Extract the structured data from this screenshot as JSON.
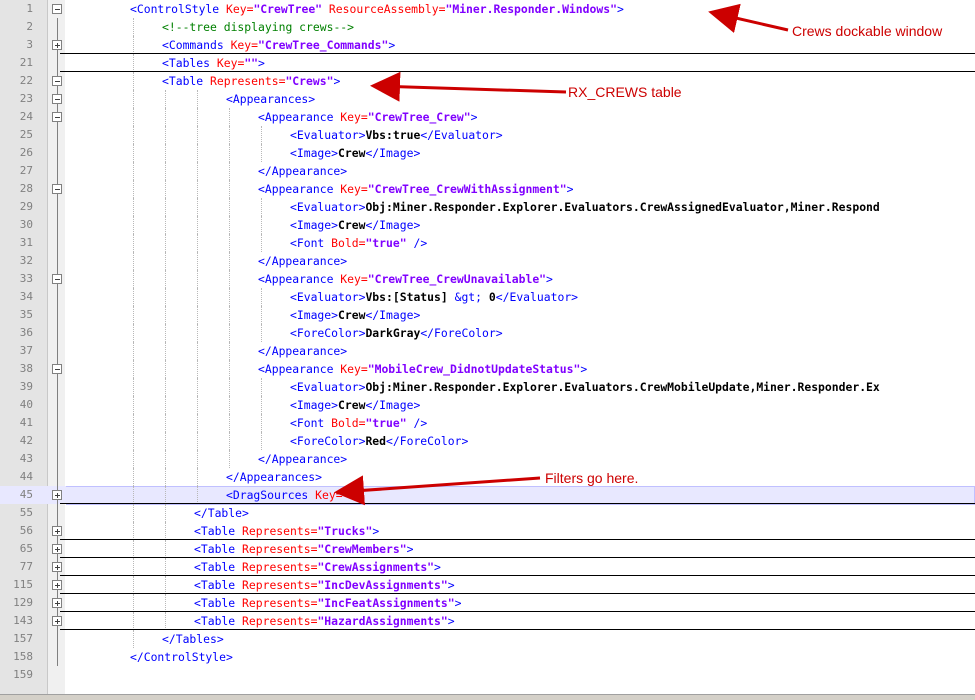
{
  "annotations": {
    "crews_window": "Crews dockable window",
    "rx_crews": "RX_CREWS table",
    "filters": "Filters go here."
  },
  "lines": [
    {
      "n": "1",
      "fold": "open",
      "parts": [
        [
          "t",
          "<ControlStyle "
        ],
        [
          "a",
          "Key="
        ],
        [
          "v",
          "\"CrewTree\""
        ],
        [
          "t",
          " "
        ],
        [
          "a",
          "ResourceAssembly="
        ],
        [
          "v",
          "\"Miner.Responder.Windows\""
        ],
        [
          "t",
          ">"
        ]
      ]
    },
    {
      "n": "2",
      "parts": [
        [
          "c",
          "<!--tree displaying crews-->"
        ]
      ]
    },
    {
      "n": "3",
      "fold": "closed",
      "parts": [
        [
          "t",
          "<Commands "
        ],
        [
          "a",
          "Key="
        ],
        [
          "v",
          "\"CrewTree_Commands\""
        ],
        [
          "t",
          ">"
        ]
      ]
    },
    {
      "n": "21",
      "parts": [
        [
          "t",
          "<Tables "
        ],
        [
          "a",
          "Key="
        ],
        [
          "v",
          "\"\""
        ],
        [
          "t",
          ">"
        ]
      ]
    },
    {
      "n": "22",
      "fold": "open",
      "parts": [
        [
          "t",
          "<Table "
        ],
        [
          "a",
          "Represents="
        ],
        [
          "v",
          "\"Crews\""
        ],
        [
          "t",
          ">"
        ]
      ]
    },
    {
      "n": "23",
      "fold": "open",
      "parts": [
        [
          "t",
          "<Appearances>"
        ]
      ]
    },
    {
      "n": "24",
      "fold": "open",
      "parts": [
        [
          "t",
          "<Appearance "
        ],
        [
          "a",
          "Key="
        ],
        [
          "v",
          "\"CrewTree_Crew\""
        ],
        [
          "t",
          ">"
        ]
      ]
    },
    {
      "n": "25",
      "parts": [
        [
          "t",
          "<Evaluator>"
        ],
        [
          "tx",
          "Vbs:true"
        ],
        [
          "t",
          "</Evaluator>"
        ]
      ]
    },
    {
      "n": "26",
      "parts": [
        [
          "t",
          "<Image>"
        ],
        [
          "tx",
          "Crew"
        ],
        [
          "t",
          "</Image>"
        ]
      ]
    },
    {
      "n": "27",
      "parts": [
        [
          "t",
          "</Appearance>"
        ]
      ]
    },
    {
      "n": "28",
      "fold": "open",
      "parts": [
        [
          "t",
          "<Appearance "
        ],
        [
          "a",
          "Key="
        ],
        [
          "v",
          "\"CrewTree_CrewWithAssignment\""
        ],
        [
          "t",
          ">"
        ]
      ]
    },
    {
      "n": "29",
      "parts": [
        [
          "t",
          "<Evaluator>"
        ],
        [
          "tx",
          "Obj:Miner.Responder.Explorer.Evaluators.CrewAssignedEvaluator,Miner.Respond"
        ]
      ]
    },
    {
      "n": "30",
      "parts": [
        [
          "t",
          "<Image>"
        ],
        [
          "tx",
          "Crew"
        ],
        [
          "t",
          "</Image>"
        ]
      ]
    },
    {
      "n": "31",
      "parts": [
        [
          "t",
          "<Font "
        ],
        [
          "a",
          "Bold="
        ],
        [
          "v",
          "\"true\""
        ],
        [
          "t",
          " />"
        ]
      ]
    },
    {
      "n": "32",
      "parts": [
        [
          "t",
          "</Appearance>"
        ]
      ]
    },
    {
      "n": "33",
      "fold": "open",
      "parts": [
        [
          "t",
          "<Appearance "
        ],
        [
          "a",
          "Key="
        ],
        [
          "v",
          "\"CrewTree_CrewUnavailable\""
        ],
        [
          "t",
          ">"
        ]
      ]
    },
    {
      "n": "34",
      "parts": [
        [
          "t",
          "<Evaluator>"
        ],
        [
          "tx",
          "Vbs:[Status] "
        ],
        [
          "t",
          "&gt;"
        ],
        [
          "tx",
          " 0"
        ],
        [
          "t",
          "</Evaluator>"
        ]
      ]
    },
    {
      "n": "35",
      "parts": [
        [
          "t",
          "<Image>"
        ],
        [
          "tx",
          "Crew"
        ],
        [
          "t",
          "</Image>"
        ]
      ]
    },
    {
      "n": "36",
      "parts": [
        [
          "t",
          "<ForeColor>"
        ],
        [
          "tx",
          "DarkGray"
        ],
        [
          "t",
          "</ForeColor>"
        ]
      ]
    },
    {
      "n": "37",
      "parts": [
        [
          "t",
          "</Appearance>"
        ]
      ]
    },
    {
      "n": "38",
      "fold": "open",
      "parts": [
        [
          "t",
          "<Appearance "
        ],
        [
          "a",
          "Key="
        ],
        [
          "v",
          "\"MobileCrew_DidnotUpdateStatus\""
        ],
        [
          "t",
          ">"
        ]
      ]
    },
    {
      "n": "39",
      "parts": [
        [
          "t",
          "<Evaluator>"
        ],
        [
          "tx",
          "Obj:Miner.Responder.Explorer.Evaluators.CrewMobileUpdate,Miner.Responder.Ex"
        ]
      ]
    },
    {
      "n": "40",
      "parts": [
        [
          "t",
          "<Image>"
        ],
        [
          "tx",
          "Crew"
        ],
        [
          "t",
          "</Image>"
        ]
      ]
    },
    {
      "n": "41",
      "parts": [
        [
          "t",
          "<Font "
        ],
        [
          "a",
          "Bold="
        ],
        [
          "v",
          "\"true\""
        ],
        [
          "t",
          " />"
        ]
      ]
    },
    {
      "n": "42",
      "parts": [
        [
          "t",
          "<ForeColor>"
        ],
        [
          "tx",
          "Red"
        ],
        [
          "t",
          "</ForeColor>"
        ]
      ]
    },
    {
      "n": "43",
      "parts": [
        [
          "t",
          "</Appearance>"
        ]
      ]
    },
    {
      "n": "44",
      "parts": [
        [
          "t",
          "</Appearances>"
        ]
      ]
    },
    {
      "n": "45",
      "fold": "closed",
      "parts": [
        [
          "t",
          "<DragSources "
        ],
        [
          "a",
          "Key="
        ],
        [
          "v",
          "\"\""
        ],
        [
          "t",
          ">"
        ]
      ]
    },
    {
      "n": "55",
      "parts": [
        [
          "t",
          "</Table>"
        ]
      ]
    },
    {
      "n": "56",
      "fold": "closed",
      "parts": [
        [
          "t",
          "<Table "
        ],
        [
          "a",
          "Represents="
        ],
        [
          "v",
          "\"Trucks\""
        ],
        [
          "t",
          ">"
        ]
      ]
    },
    {
      "n": "65",
      "fold": "closed",
      "parts": [
        [
          "t",
          "<Table "
        ],
        [
          "a",
          "Represents="
        ],
        [
          "v",
          "\"CrewMembers\""
        ],
        [
          "t",
          ">"
        ]
      ]
    },
    {
      "n": "77",
      "fold": "closed",
      "parts": [
        [
          "t",
          "<Table "
        ],
        [
          "a",
          "Represents="
        ],
        [
          "v",
          "\"CrewAssignments\""
        ],
        [
          "t",
          ">"
        ]
      ]
    },
    {
      "n": "115",
      "fold": "closed",
      "parts": [
        [
          "t",
          "<Table "
        ],
        [
          "a",
          "Represents="
        ],
        [
          "v",
          "\"IncDevAssignments\""
        ],
        [
          "t",
          ">"
        ]
      ]
    },
    {
      "n": "129",
      "fold": "closed",
      "parts": [
        [
          "t",
          "<Table "
        ],
        [
          "a",
          "Represents="
        ],
        [
          "v",
          "\"IncFeatAssignments\""
        ],
        [
          "t",
          ">"
        ]
      ]
    },
    {
      "n": "143",
      "fold": "closed",
      "parts": [
        [
          "t",
          "<Table "
        ],
        [
          "a",
          "Represents="
        ],
        [
          "v",
          "\"HazardAssignments\""
        ],
        [
          "t",
          ">"
        ]
      ]
    },
    {
      "n": "157",
      "parts": [
        [
          "t",
          "</Tables>"
        ]
      ]
    },
    {
      "n": "158",
      "parts": [
        [
          "t",
          "</ControlStyle>"
        ]
      ]
    },
    {
      "n": "159",
      "parts": []
    }
  ]
}
